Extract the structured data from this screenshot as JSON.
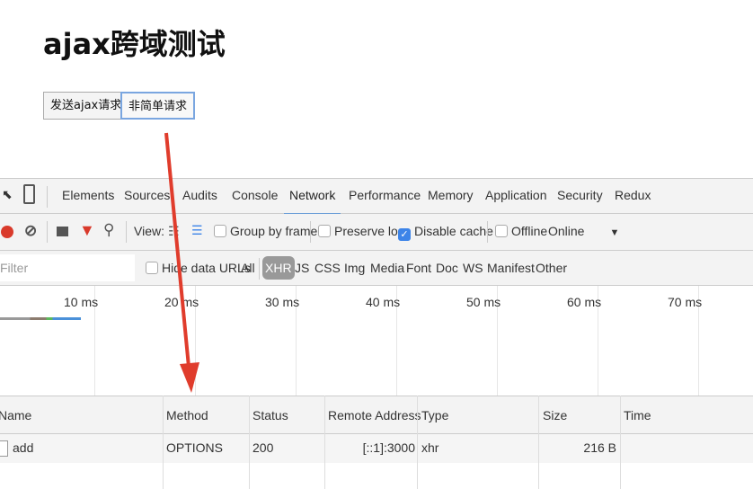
{
  "page": {
    "title": "ajax跨域测试",
    "buttons": [
      "发送ajax请求",
      "非简单请求"
    ]
  },
  "devtools": {
    "tabs": [
      "Elements",
      "Sources",
      "Audits",
      "Console",
      "Network",
      "Performance",
      "Memory",
      "Application",
      "Security",
      "Redux"
    ],
    "active_tab": "Network",
    "toolbar": {
      "view_label": "View:",
      "group_by_frame": "Group by frame",
      "preserve_log": "Preserve log",
      "disable_cache": "Disable cache",
      "offline": "Offline",
      "throttle": "Online",
      "disable_cache_checked": true
    },
    "filter": {
      "placeholder": "Filter",
      "hide_data_urls": "Hide data URLs",
      "types": [
        "All",
        "XHR",
        "JS",
        "CSS",
        "Img",
        "Media",
        "Font",
        "Doc",
        "WS",
        "Manifest",
        "Other"
      ],
      "active_type": "XHR"
    },
    "timeline_ticks": [
      "10 ms",
      "20 ms",
      "30 ms",
      "40 ms",
      "50 ms",
      "60 ms",
      "70 ms"
    ],
    "table": {
      "columns": [
        "Name",
        "Method",
        "Status",
        "Remote Address",
        "Type",
        "Size",
        "Time"
      ],
      "rows": [
        {
          "name": "add",
          "method": "OPTIONS",
          "status": "200",
          "remote": "[::1]:3000",
          "type": "xhr",
          "size": "216 B",
          "time": ""
        }
      ]
    }
  },
  "colors": {
    "arrow": "#e03c2c",
    "accent": "#3d84e8"
  }
}
